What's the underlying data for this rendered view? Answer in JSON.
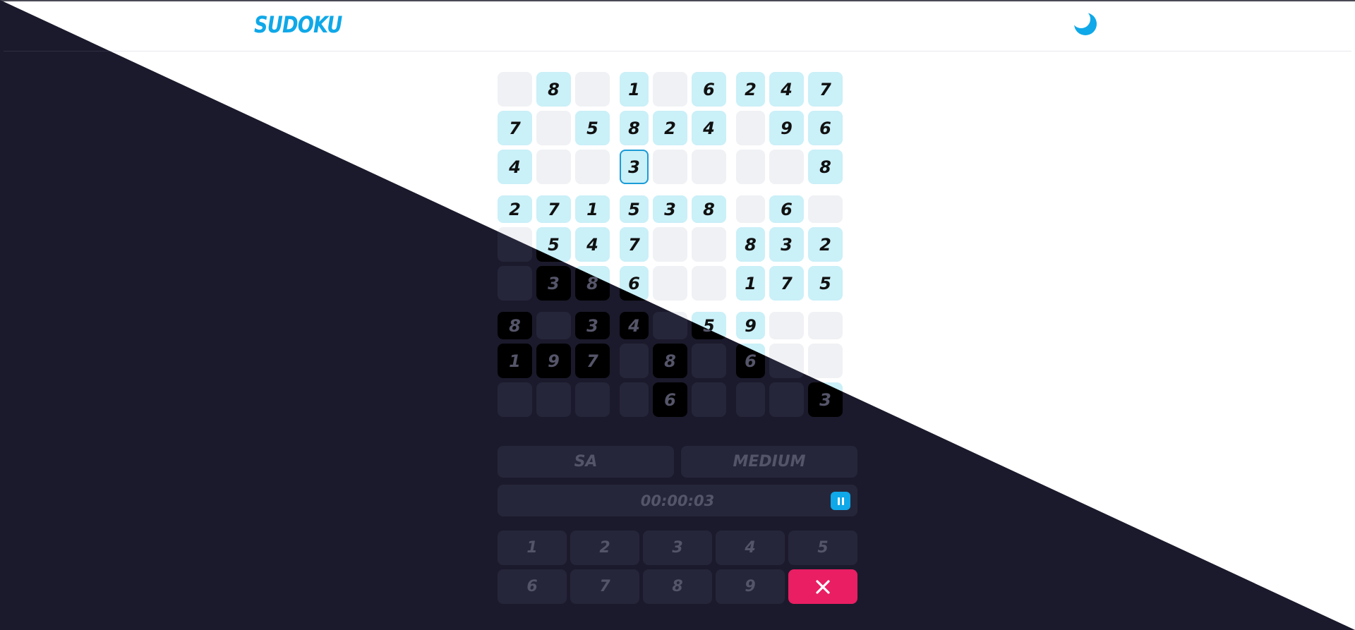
{
  "header": {
    "logo": "SUDOKU",
    "theme_toggle_icon": "moon-icon"
  },
  "colors": {
    "accent": "#0fa8e8",
    "given_cell": "#caf0f8",
    "empty_cell": "#f0f1f4",
    "erase": "#e91e63",
    "dark_bg": "#1b1a2c"
  },
  "board": {
    "rows": [
      [
        "",
        "8",
        "",
        "1",
        "",
        "6",
        "2",
        "4",
        "7"
      ],
      [
        "7",
        "",
        "5",
        "8",
        "2",
        "4",
        "",
        "9",
        "6"
      ],
      [
        "4",
        "",
        "",
        "3",
        "",
        "",
        "",
        "",
        "8"
      ],
      [
        "2",
        "7",
        "1",
        "5",
        "3",
        "8",
        "",
        "6",
        ""
      ],
      [
        "",
        "5",
        "4",
        "7",
        "",
        "",
        "8",
        "3",
        "2"
      ],
      [
        "",
        "3",
        "8",
        "6",
        "",
        "",
        "1",
        "7",
        "5"
      ],
      [
        "8",
        "",
        "3",
        "4",
        "",
        "5",
        "9",
        "",
        ""
      ],
      [
        "1",
        "9",
        "7",
        "",
        "8",
        "",
        "6",
        "",
        ""
      ],
      [
        "",
        "",
        "",
        "",
        "6",
        "",
        "",
        "",
        "3"
      ]
    ],
    "selected": [
      2,
      3
    ]
  },
  "info": {
    "player": "SA",
    "difficulty": "MEDIUM",
    "timer": "00:00:03"
  },
  "numpad": {
    "keys": [
      "1",
      "2",
      "3",
      "4",
      "5",
      "6",
      "7",
      "8",
      "9"
    ],
    "erase_icon": "close-icon"
  }
}
